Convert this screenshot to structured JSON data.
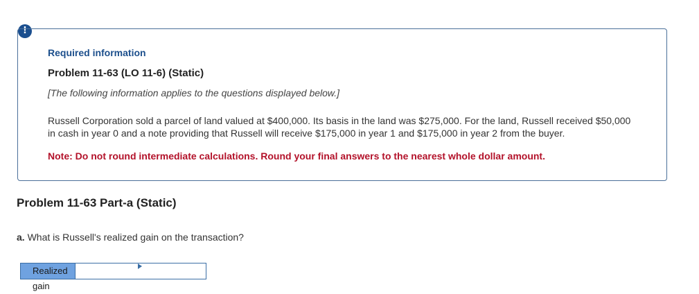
{
  "alert": {
    "icon_name": "exclamation-icon",
    "glyph": "!"
  },
  "info": {
    "heading": "Required information",
    "problem_title": "Problem 11-63 (LO 11-6) (Static)",
    "applies_note": "[The following information applies to the questions displayed below.]",
    "body": "Russell Corporation sold a parcel of land valued at $400,000. Its basis in the land was $275,000. For the land, Russell received $50,000 in cash in year 0 and a note providing that Russell will receive $175,000 in year 1 and $175,000 in year 2 from the buyer.",
    "note": "Note: Do not round intermediate calculations. Round your final answers to the nearest whole dollar amount."
  },
  "part": {
    "title": "Problem 11-63 Part-a (Static)",
    "question_letter": "a.",
    "question_text": "What is Russell's realized gain on the transaction?"
  },
  "answer": {
    "label": "Realized gain",
    "value": ""
  },
  "colors": {
    "accent_blue": "#1c4f8c",
    "note_red": "#b3122a",
    "label_fill": "#6fa2e0"
  }
}
